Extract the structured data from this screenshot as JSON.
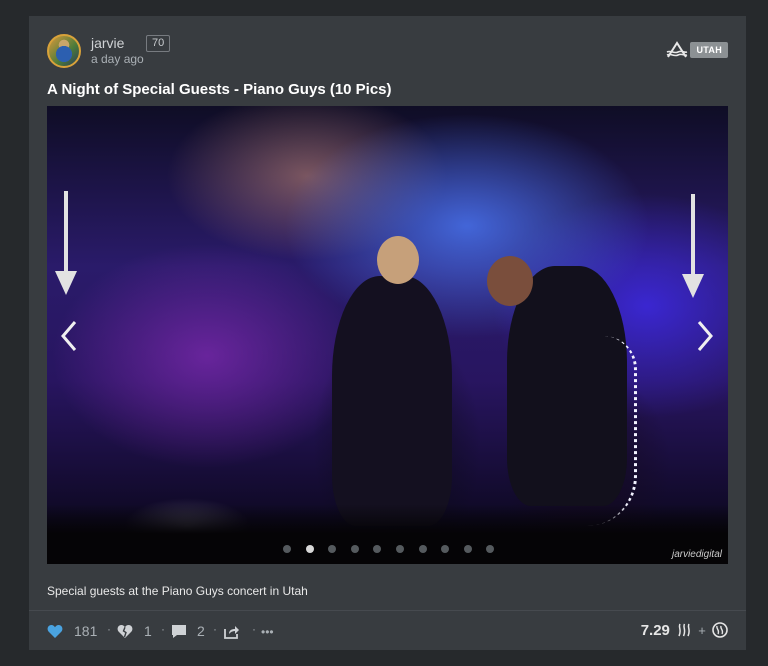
{
  "post": {
    "author": "jarvie",
    "reputation": "70",
    "timestamp": "a day ago",
    "community_tag": "UTAH",
    "title": "A Night of Special Guests - Piano Guys (10 Pics)",
    "caption": "Special guests at the Piano Guys concert in Utah",
    "watermark": "jarviedigital"
  },
  "carousel": {
    "total_slides": 10,
    "active_index": 1
  },
  "footer": {
    "upvotes": "181",
    "downvotes": "1",
    "comments": "2",
    "more": "•••",
    "payout": "7.29",
    "plus": "+"
  },
  "colors": {
    "heart": "#4aa3e0",
    "background": "#26292c",
    "card": "#383c40"
  }
}
